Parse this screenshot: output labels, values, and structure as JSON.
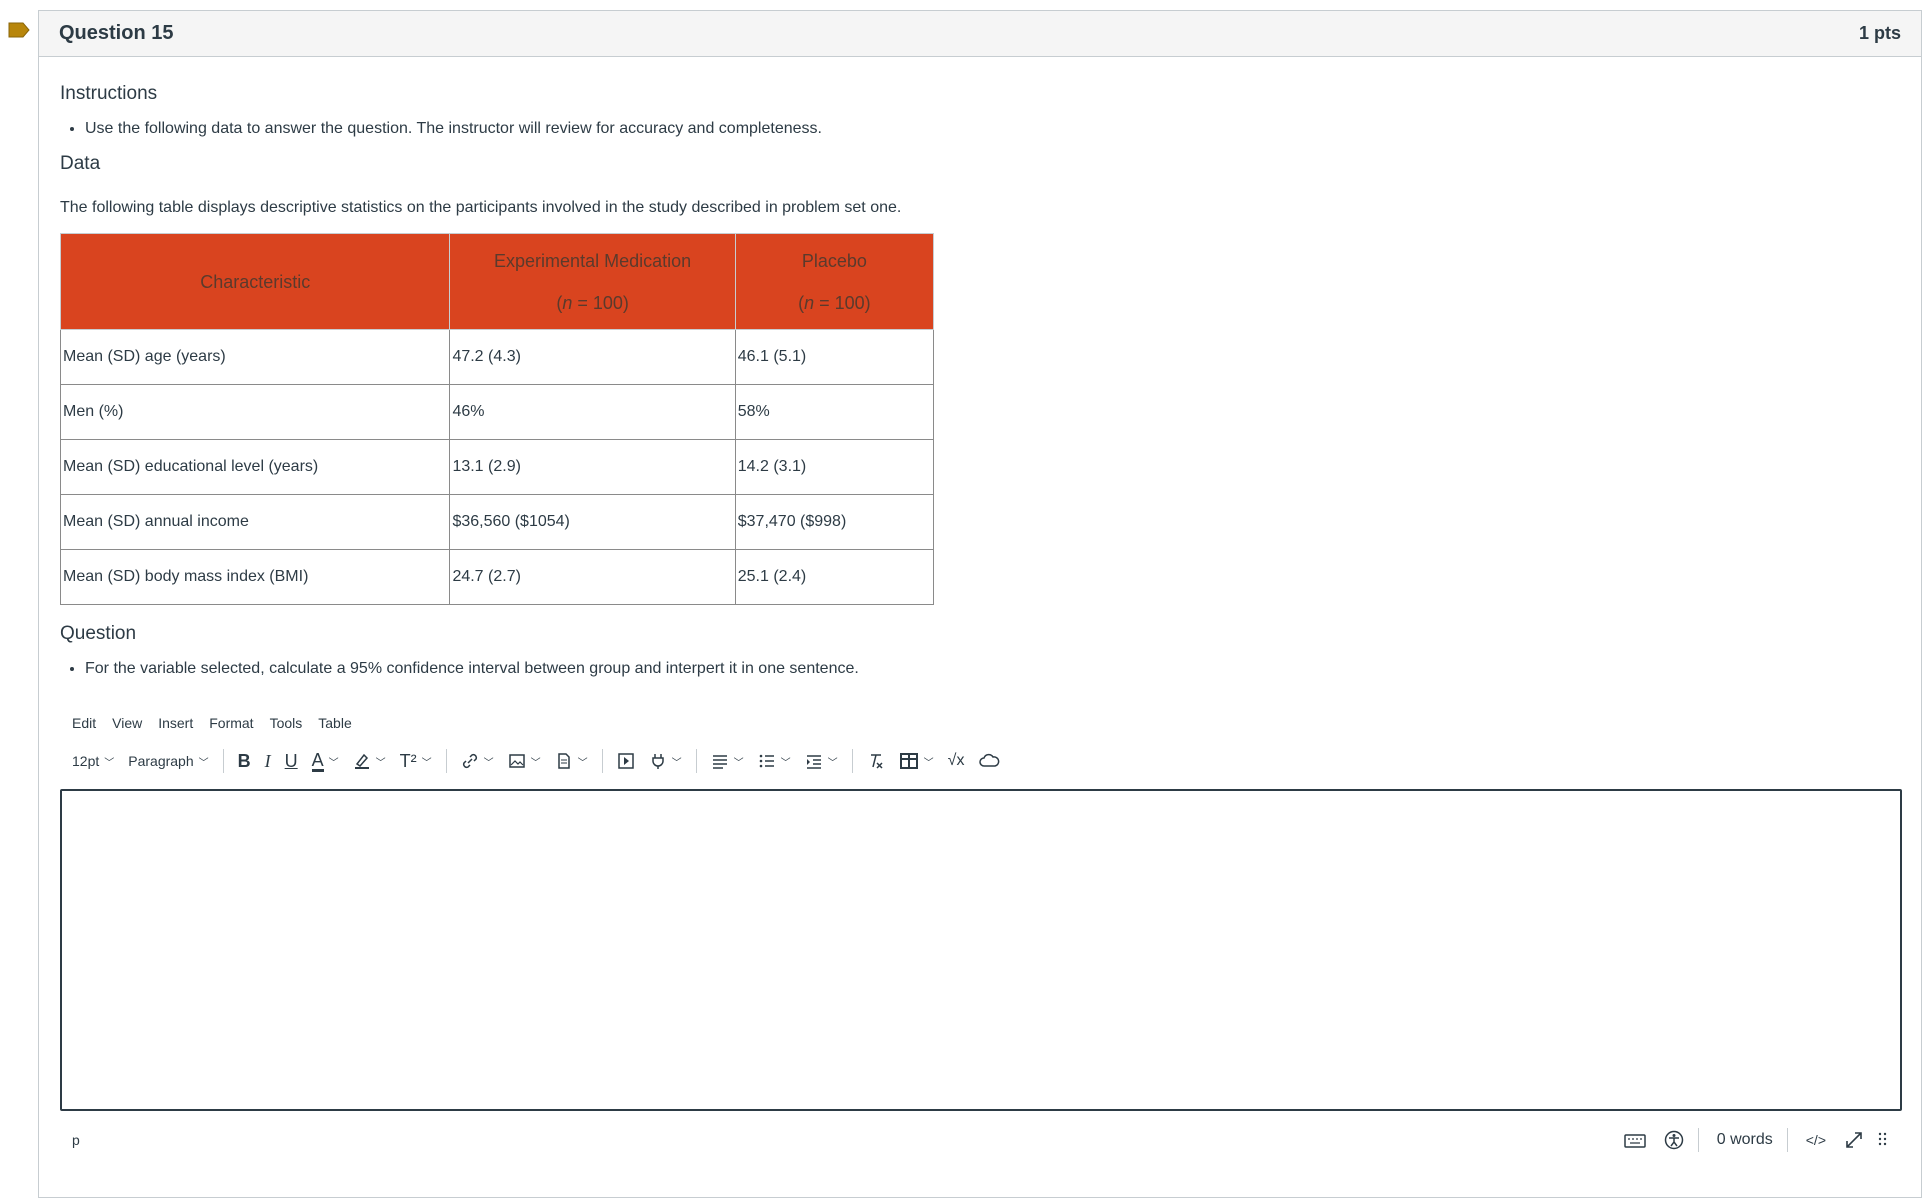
{
  "question": {
    "title": "Question 15",
    "points": "1 pts"
  },
  "instructions": {
    "heading": "Instructions",
    "items": [
      "Use the following data to answer the question. The instructor will review for accuracy and completeness."
    ]
  },
  "data_section": {
    "heading": "Data",
    "description": "The following table displays descriptive statistics on the participants involved in the study described in problem set one."
  },
  "table": {
    "header": {
      "characteristic": "Characteristic",
      "experimental": "Experimental Medication",
      "placebo": "Placebo",
      "n_label": "n",
      "n_value": " = 100)",
      "open_paren": "("
    },
    "rows": [
      {
        "label": "Mean (SD) age (years)",
        "experimental": "47.2 (4.3)",
        "placebo": "46.1 (5.1)"
      },
      {
        "label": "Men (%)",
        "experimental": "46%",
        "placebo": "58%"
      },
      {
        "label": "Mean (SD) educational level (years)",
        "experimental": "13.1 (2.9)",
        "placebo": "14.2 (3.1)"
      },
      {
        "label": "Mean (SD) annual income",
        "experimental": "$36,560 ($1054)",
        "placebo": "$37,470 ($998)"
      },
      {
        "label": "Mean (SD) body mass index (BMI)",
        "experimental": "24.7 (2.7)",
        "placebo": "25.1 (2.4)"
      }
    ],
    "header_color": "#d9441f"
  },
  "question_section": {
    "heading": "Question",
    "items": [
      "For the variable selected, calculate a 95% confidence interval between group and interpert it in one sentence."
    ]
  },
  "editor": {
    "menu": [
      "Edit",
      "View",
      "Insert",
      "Format",
      "Tools",
      "Table"
    ],
    "font_size": "12pt",
    "block_format": "Paragraph",
    "status_path": "p",
    "word_count": "0 words",
    "html_toggle": "</>"
  }
}
